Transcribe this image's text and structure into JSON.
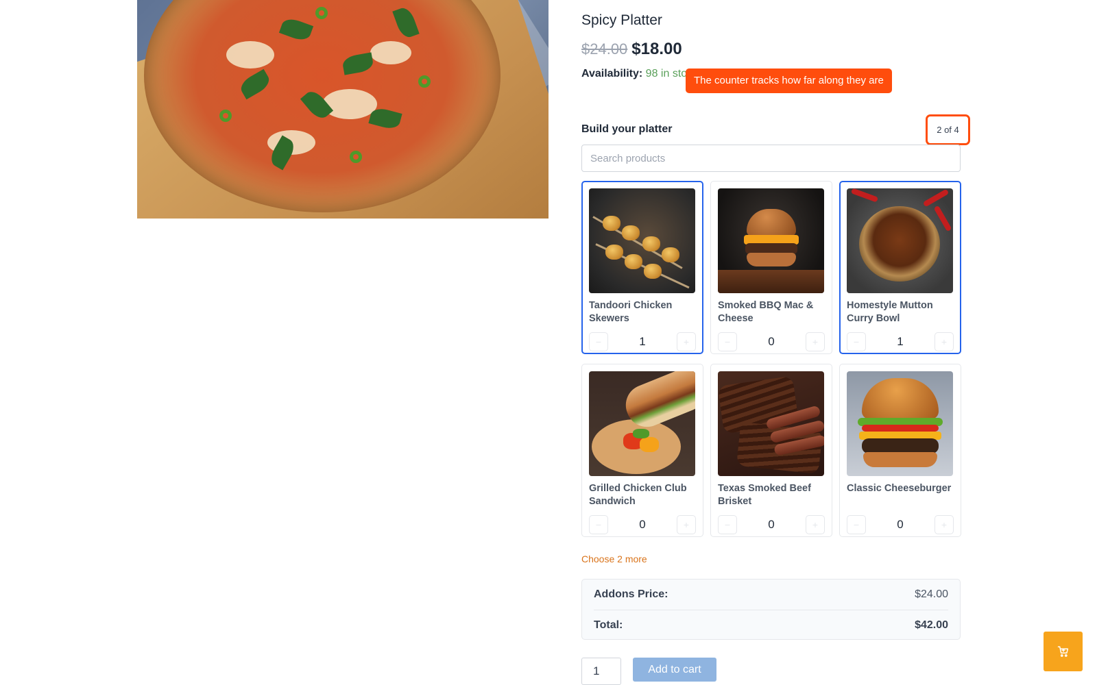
{
  "product": {
    "title": "Spicy Platter",
    "old_price": "$24.00",
    "new_price": "$18.00",
    "availability_label": "Availability:",
    "availability_value": "98 in stock"
  },
  "tooltip": {
    "text": "The counter tracks how far along they are"
  },
  "builder": {
    "title": "Build your platter",
    "counter": "2 of 4",
    "search_placeholder": "Search products",
    "items": [
      {
        "name": "Tandoori Chicken Skewers",
        "qty": "1",
        "selected": true
      },
      {
        "name": "Smoked BBQ Mac & Cheese",
        "qty": "0",
        "selected": false
      },
      {
        "name": "Homestyle Mutton Curry Bowl",
        "qty": "1",
        "selected": true
      },
      {
        "name": "Grilled Chicken Club Sandwich",
        "qty": "0",
        "selected": false
      },
      {
        "name": "Texas Smoked Beef Brisket",
        "qty": "0",
        "selected": false
      },
      {
        "name": "Classic Cheeseburger",
        "qty": "0",
        "selected": false
      }
    ],
    "choose_more": "Choose 2 more"
  },
  "summary": {
    "addons_label": "Addons Price:",
    "addons_value": "$24.00",
    "total_label": "Total:",
    "total_value": "$42.00"
  },
  "cart": {
    "quantity": "1",
    "add_label": "Add to cart"
  },
  "colors": {
    "accent": "#ff4d0d",
    "selected_border": "#2563eb",
    "fab": "#f7a41c",
    "button": "#8fb4e0"
  },
  "icons": {
    "minus": "minus-icon",
    "plus": "plus-icon",
    "cart": "cart-icon"
  }
}
